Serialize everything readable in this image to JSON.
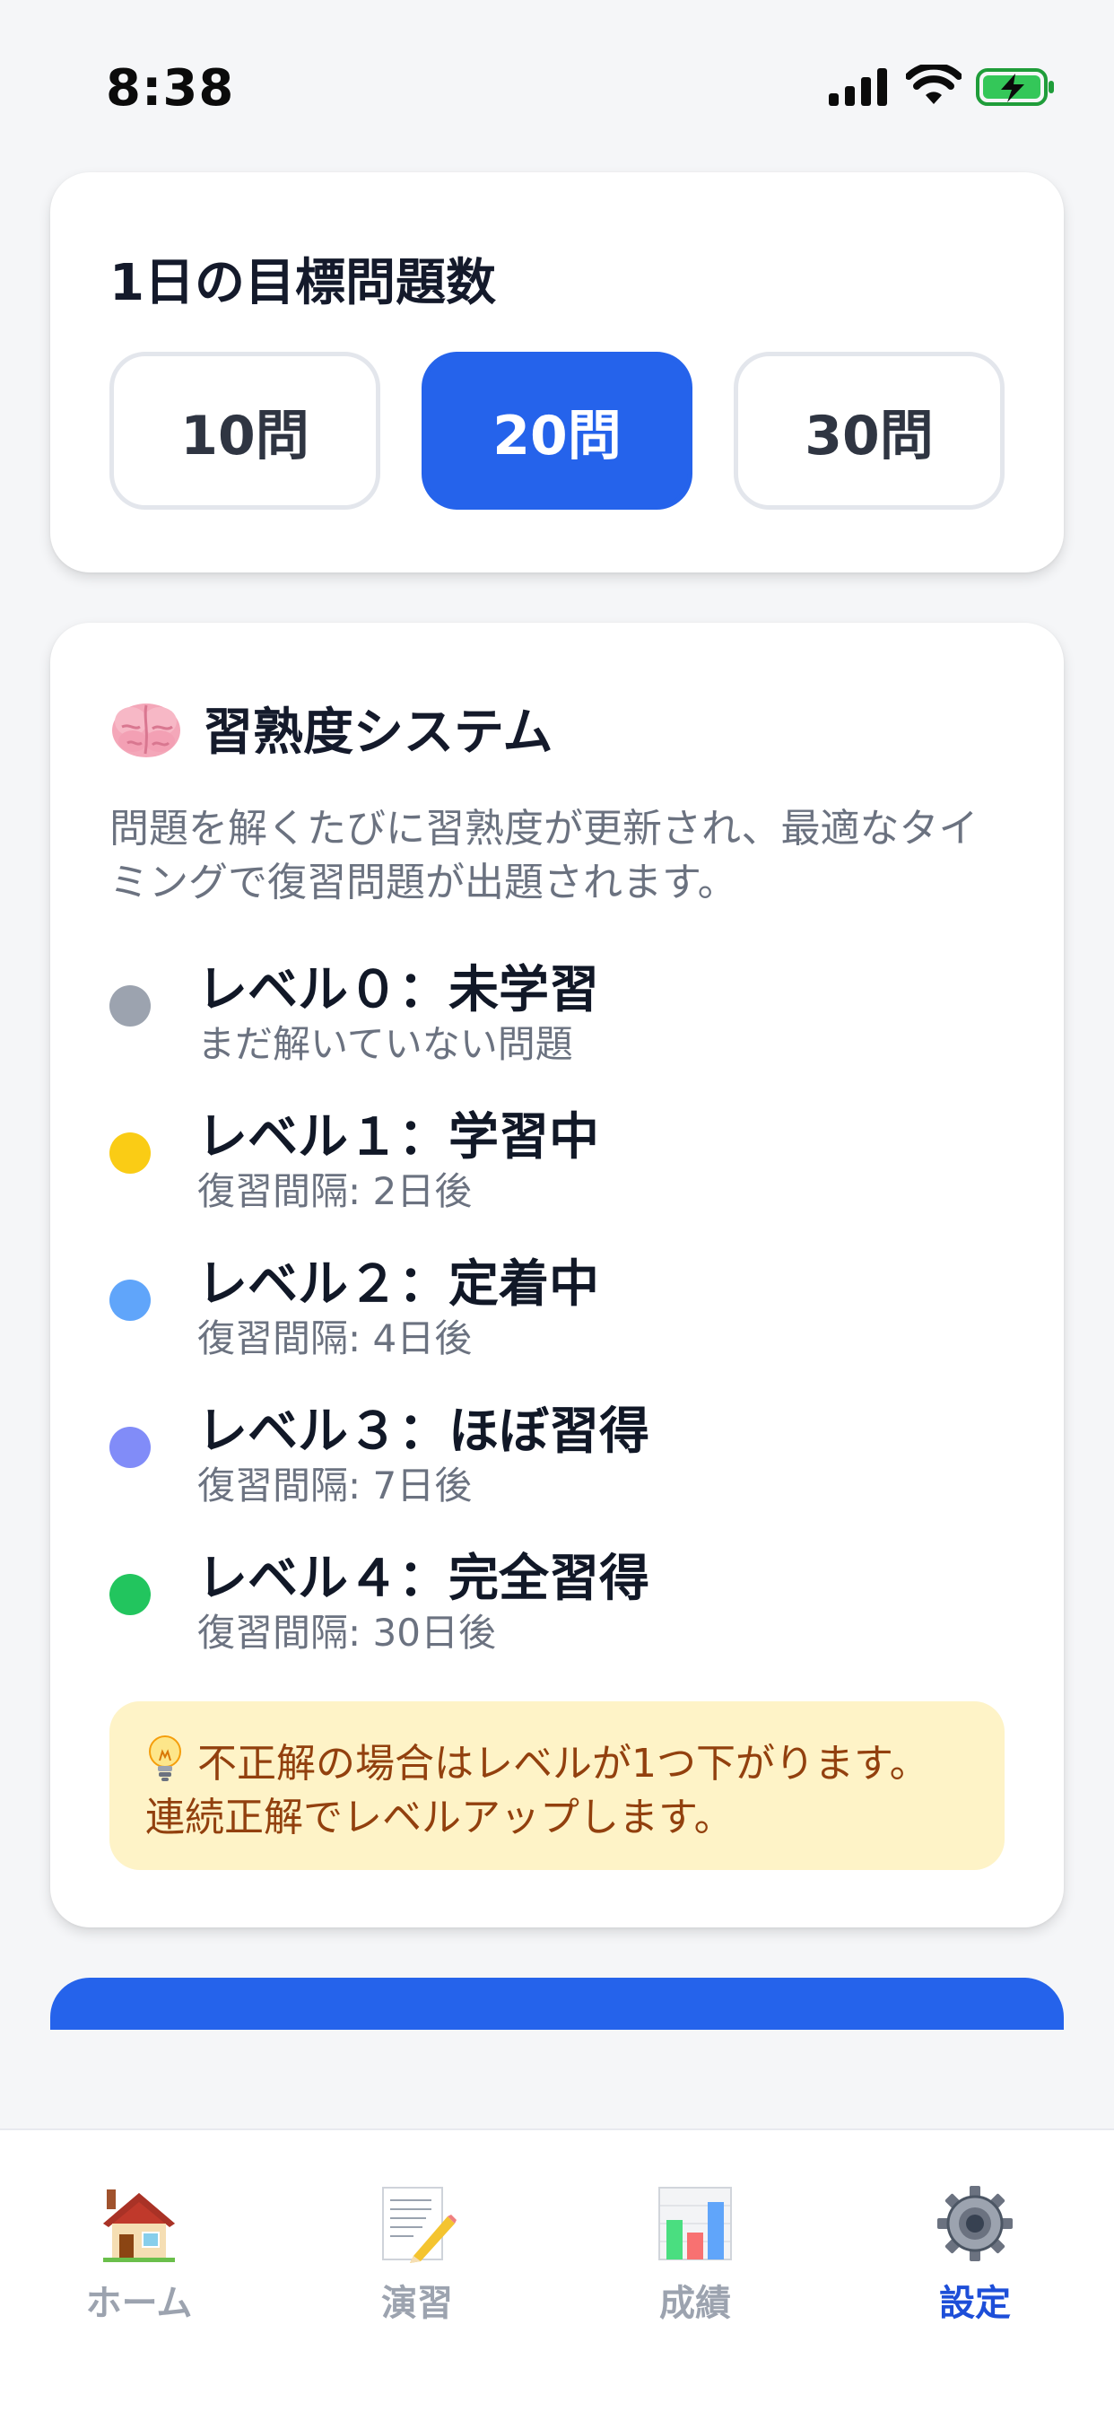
{
  "status_bar": {
    "time": "8:38"
  },
  "goal": {
    "title": "1日の目標問題数",
    "options": [
      "10問",
      "20問",
      "30問"
    ],
    "selected": "20問"
  },
  "mastery": {
    "icon": "brain-icon",
    "title": "習熟度システム",
    "description": "問題を解くたびに習熟度が更新され、最適なタイミングで復習問題が出題されます。",
    "levels": [
      {
        "title": "レベル０：未学習",
        "subtitle": "まだ解いていない問題",
        "color": "#9ca3af"
      },
      {
        "title": "レベル１：学習中",
        "subtitle": "復習間隔: 2日後",
        "color": "#facc15"
      },
      {
        "title": "レベル２：定着中",
        "subtitle": "復習間隔: 4日後",
        "color": "#60a5fa"
      },
      {
        "title": "レベル３：ほぼ習得",
        "subtitle": "復習間隔: 7日後",
        "color": "#818cf8"
      },
      {
        "title": "レベル４：完全習得",
        "subtitle": "復習間隔: 30日後",
        "color": "#22c55e"
      }
    ],
    "tip": {
      "icon": "lightbulb-icon",
      "line1": "不正解の場合はレベルが1つ下がります。",
      "line2": "連続正解でレベルアップします。"
    }
  },
  "tab_bar": {
    "active": "設定",
    "items": [
      {
        "label": "ホーム",
        "icon": "house-icon"
      },
      {
        "label": "演習",
        "icon": "memo-pencil-icon"
      },
      {
        "label": "成績",
        "icon": "bar-chart-icon"
      },
      {
        "label": "設定",
        "icon": "gear-icon"
      }
    ]
  },
  "colors": {
    "accent": "#2563eb",
    "background": "#f5f6f8",
    "tip_background": "#fef3c7",
    "tip_text": "#92400e"
  }
}
